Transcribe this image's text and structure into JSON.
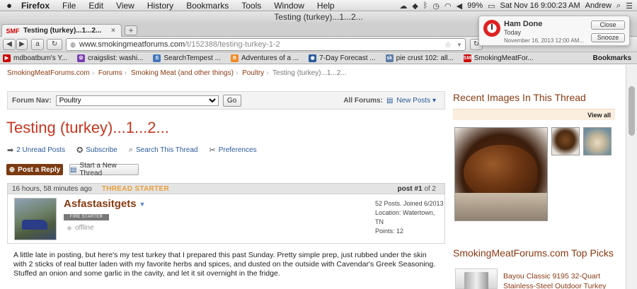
{
  "menubar": {
    "apple": "",
    "items": [
      "Firefox",
      "File",
      "Edit",
      "View",
      "History",
      "Bookmarks",
      "Tools",
      "Window",
      "Help"
    ],
    "battery": "99%",
    "clock": "Sat Nov 16  9:00:23 AM",
    "user": "Andrew"
  },
  "window": {
    "title": "Testing (turkey)...1...2..."
  },
  "tabs": [
    {
      "favicon": "SMF",
      "title": "Testing (turkey)...1...2...",
      "close": "×"
    }
  ],
  "new_tab": "+",
  "nav": {
    "url_prefix": "www.smokingmeatforums.com",
    "url_path": "/t/152388/testing-turkey-1-2"
  },
  "bookmarks": [
    {
      "label": "mdboatbum's Y...",
      "color": "#cc0000",
      "icon": "▶"
    },
    {
      "label": "craigslist: washi...",
      "color": "#7a3fb0",
      "icon": "☮"
    },
    {
      "label": "SearchTempest ...",
      "color": "#4477bb",
      "icon": "S"
    },
    {
      "label": "Adventures of a ...",
      "color": "#f08a24",
      "icon": "B"
    },
    {
      "label": "7-Day Forecast ...",
      "color": "#2b5a9c",
      "icon": "◉"
    },
    {
      "label": "pie crust 102: all...",
      "color": "#5a7aa6",
      "icon": "sk"
    },
    {
      "label": "SmokingMeatFor...",
      "color": "#cc0000",
      "icon": "SMF"
    }
  ],
  "bookmarks_menu": "Bookmarks",
  "breadcrumb": [
    "SmokingMeatForums.com",
    "Forums",
    "Smoking Meat (and other things)",
    "Poultry",
    "Testing (turkey)...1...2..."
  ],
  "forum_nav": {
    "label": "Forum Nav:",
    "selected": "Poultry",
    "go": "Go",
    "all_forums": "All Forums:",
    "new_posts": "New Posts"
  },
  "thread": {
    "title": "Testing (turkey)...1...2...",
    "actions": [
      {
        "icon": "unread-icon",
        "glyph": "➡",
        "label": "2 Unread Posts"
      },
      {
        "icon": "subscribe-icon",
        "glyph": "✪",
        "label": "Subscribe"
      },
      {
        "icon": "search-icon",
        "glyph": "⌕",
        "label": "Search This Thread"
      },
      {
        "icon": "tools-icon",
        "glyph": "✂",
        "label": "Preferences"
      }
    ],
    "post_reply": "Post a Reply",
    "new_thread": "Start a New Thread"
  },
  "post": {
    "time": "16 hours, 58 minutes ago",
    "starter": "THREAD STARTER",
    "post_label": "post",
    "post_number": "#1",
    "of": "of 2",
    "author": "Asfastasitgets",
    "rank": "FIRE STARTER",
    "status": "offline",
    "stats": [
      "52 Posts. Joined 6/2013",
      "Location: Watertown, TN",
      "Points: 12"
    ],
    "body": "A little late in posting, but here's my test turkey that I prepared this past Sunday. Pretty simple prep, just rubbed under the skin with 2 sticks of real butter laden with my favorite herbs and spices, and dusted on the outside with Cavendar's Greek Seasoning. Stuffed an onion and some garlic in the cavity, and let it sit overnight in the fridge."
  },
  "sidebar": {
    "recent_images": "Recent Images In This Thread",
    "view_all": "View all",
    "top_picks": "SmokingMeatForums.com Top Picks",
    "pick_text": "Bayou Classic 9195 32-Quart Stainless-Steel Outdoor Turkey"
  },
  "notification": {
    "title": "Ham Done",
    "subtitle": "Today",
    "date": "November 16, 2013 12:00 AM...",
    "close": "Close",
    "snooze": "Snooze"
  },
  "colors": {
    "accent": "#c8351e",
    "brand": "#8a3a12",
    "link": "#2b5a9c"
  }
}
